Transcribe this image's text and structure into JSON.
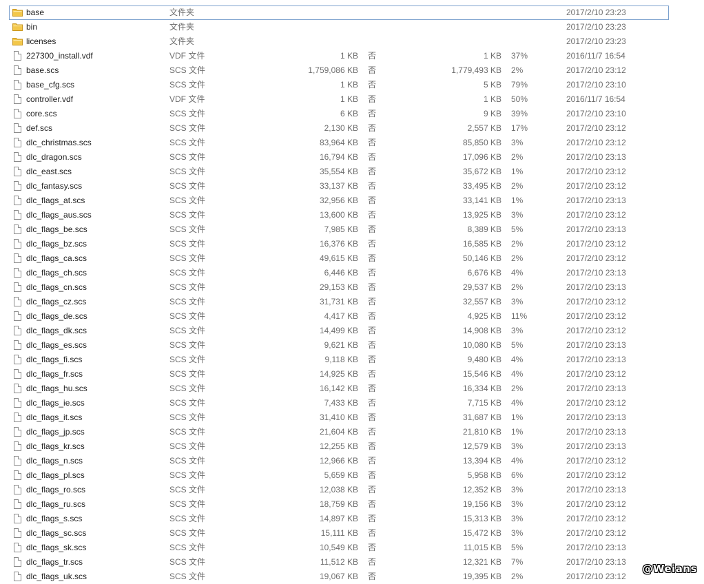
{
  "files": [
    {
      "icon": "folder-icon",
      "name": "base",
      "type": "文件夹",
      "size": "",
      "encrypted": "",
      "packed": "",
      "ratio": "",
      "date": "2017/2/10 23:23"
    },
    {
      "icon": "folder-icon",
      "name": "bin",
      "type": "文件夹",
      "size": "",
      "encrypted": "",
      "packed": "",
      "ratio": "",
      "date": "2017/2/10 23:23"
    },
    {
      "icon": "folder-icon",
      "name": "licenses",
      "type": "文件夹",
      "size": "",
      "encrypted": "",
      "packed": "",
      "ratio": "",
      "date": "2017/2/10 23:23"
    },
    {
      "icon": "file-icon",
      "name": "227300_install.vdf",
      "type": "VDF 文件",
      "size": "1 KB",
      "encrypted": "否",
      "packed": "1 KB",
      "ratio": "37%",
      "date": "2016/11/7 16:54"
    },
    {
      "icon": "file-icon",
      "name": "base.scs",
      "type": "SCS 文件",
      "size": "1,759,086 KB",
      "encrypted": "否",
      "packed": "1,779,493 KB",
      "ratio": "2%",
      "date": "2017/2/10 23:12"
    },
    {
      "icon": "file-icon",
      "name": "base_cfg.scs",
      "type": "SCS 文件",
      "size": "1 KB",
      "encrypted": "否",
      "packed": "5 KB",
      "ratio": "79%",
      "date": "2017/2/10 23:10"
    },
    {
      "icon": "file-icon",
      "name": "controller.vdf",
      "type": "VDF 文件",
      "size": "1 KB",
      "encrypted": "否",
      "packed": "1 KB",
      "ratio": "50%",
      "date": "2016/11/7 16:54"
    },
    {
      "icon": "file-icon",
      "name": "core.scs",
      "type": "SCS 文件",
      "size": "6 KB",
      "encrypted": "否",
      "packed": "9 KB",
      "ratio": "39%",
      "date": "2017/2/10 23:10"
    },
    {
      "icon": "file-icon",
      "name": "def.scs",
      "type": "SCS 文件",
      "size": "2,130 KB",
      "encrypted": "否",
      "packed": "2,557 KB",
      "ratio": "17%",
      "date": "2017/2/10 23:12"
    },
    {
      "icon": "file-icon",
      "name": "dlc_christmas.scs",
      "type": "SCS 文件",
      "size": "83,964 KB",
      "encrypted": "否",
      "packed": "85,850 KB",
      "ratio": "3%",
      "date": "2017/2/10 23:12"
    },
    {
      "icon": "file-icon",
      "name": "dlc_dragon.scs",
      "type": "SCS 文件",
      "size": "16,794 KB",
      "encrypted": "否",
      "packed": "17,096 KB",
      "ratio": "2%",
      "date": "2017/2/10 23:13"
    },
    {
      "icon": "file-icon",
      "name": "dlc_east.scs",
      "type": "SCS 文件",
      "size": "35,554 KB",
      "encrypted": "否",
      "packed": "35,672 KB",
      "ratio": "1%",
      "date": "2017/2/10 23:12"
    },
    {
      "icon": "file-icon",
      "name": "dlc_fantasy.scs",
      "type": "SCS 文件",
      "size": "33,137 KB",
      "encrypted": "否",
      "packed": "33,495 KB",
      "ratio": "2%",
      "date": "2017/2/10 23:12"
    },
    {
      "icon": "file-icon",
      "name": "dlc_flags_at.scs",
      "type": "SCS 文件",
      "size": "32,956 KB",
      "encrypted": "否",
      "packed": "33,141 KB",
      "ratio": "1%",
      "date": "2017/2/10 23:13"
    },
    {
      "icon": "file-icon",
      "name": "dlc_flags_aus.scs",
      "type": "SCS 文件",
      "size": "13,600 KB",
      "encrypted": "否",
      "packed": "13,925 KB",
      "ratio": "3%",
      "date": "2017/2/10 23:12"
    },
    {
      "icon": "file-icon",
      "name": "dlc_flags_be.scs",
      "type": "SCS 文件",
      "size": "7,985 KB",
      "encrypted": "否",
      "packed": "8,389 KB",
      "ratio": "5%",
      "date": "2017/2/10 23:13"
    },
    {
      "icon": "file-icon",
      "name": "dlc_flags_bz.scs",
      "type": "SCS 文件",
      "size": "16,376 KB",
      "encrypted": "否",
      "packed": "16,585 KB",
      "ratio": "2%",
      "date": "2017/2/10 23:12"
    },
    {
      "icon": "file-icon",
      "name": "dlc_flags_ca.scs",
      "type": "SCS 文件",
      "size": "49,615 KB",
      "encrypted": "否",
      "packed": "50,146 KB",
      "ratio": "2%",
      "date": "2017/2/10 23:12"
    },
    {
      "icon": "file-icon",
      "name": "dlc_flags_ch.scs",
      "type": "SCS 文件",
      "size": "6,446 KB",
      "encrypted": "否",
      "packed": "6,676 KB",
      "ratio": "4%",
      "date": "2017/2/10 23:13"
    },
    {
      "icon": "file-icon",
      "name": "dlc_flags_cn.scs",
      "type": "SCS 文件",
      "size": "29,153 KB",
      "encrypted": "否",
      "packed": "29,537 KB",
      "ratio": "2%",
      "date": "2017/2/10 23:13"
    },
    {
      "icon": "file-icon",
      "name": "dlc_flags_cz.scs",
      "type": "SCS 文件",
      "size": "31,731 KB",
      "encrypted": "否",
      "packed": "32,557 KB",
      "ratio": "3%",
      "date": "2017/2/10 23:12"
    },
    {
      "icon": "file-icon",
      "name": "dlc_flags_de.scs",
      "type": "SCS 文件",
      "size": "4,417 KB",
      "encrypted": "否",
      "packed": "4,925 KB",
      "ratio": "11%",
      "date": "2017/2/10 23:12"
    },
    {
      "icon": "file-icon",
      "name": "dlc_flags_dk.scs",
      "type": "SCS 文件",
      "size": "14,499 KB",
      "encrypted": "否",
      "packed": "14,908 KB",
      "ratio": "3%",
      "date": "2017/2/10 23:12"
    },
    {
      "icon": "file-icon",
      "name": "dlc_flags_es.scs",
      "type": "SCS 文件",
      "size": "9,621 KB",
      "encrypted": "否",
      "packed": "10,080 KB",
      "ratio": "5%",
      "date": "2017/2/10 23:13"
    },
    {
      "icon": "file-icon",
      "name": "dlc_flags_fi.scs",
      "type": "SCS 文件",
      "size": "9,118 KB",
      "encrypted": "否",
      "packed": "9,480 KB",
      "ratio": "4%",
      "date": "2017/2/10 23:13"
    },
    {
      "icon": "file-icon",
      "name": "dlc_flags_fr.scs",
      "type": "SCS 文件",
      "size": "14,925 KB",
      "encrypted": "否",
      "packed": "15,546 KB",
      "ratio": "4%",
      "date": "2017/2/10 23:12"
    },
    {
      "icon": "file-icon",
      "name": "dlc_flags_hu.scs",
      "type": "SCS 文件",
      "size": "16,142 KB",
      "encrypted": "否",
      "packed": "16,334 KB",
      "ratio": "2%",
      "date": "2017/2/10 23:13"
    },
    {
      "icon": "file-icon",
      "name": "dlc_flags_ie.scs",
      "type": "SCS 文件",
      "size": "7,433 KB",
      "encrypted": "否",
      "packed": "7,715 KB",
      "ratio": "4%",
      "date": "2017/2/10 23:12"
    },
    {
      "icon": "file-icon",
      "name": "dlc_flags_it.scs",
      "type": "SCS 文件",
      "size": "31,410 KB",
      "encrypted": "否",
      "packed": "31,687 KB",
      "ratio": "1%",
      "date": "2017/2/10 23:13"
    },
    {
      "icon": "file-icon",
      "name": "dlc_flags_jp.scs",
      "type": "SCS 文件",
      "size": "21,604 KB",
      "encrypted": "否",
      "packed": "21,810 KB",
      "ratio": "1%",
      "date": "2017/2/10 23:13"
    },
    {
      "icon": "file-icon",
      "name": "dlc_flags_kr.scs",
      "type": "SCS 文件",
      "size": "12,255 KB",
      "encrypted": "否",
      "packed": "12,579 KB",
      "ratio": "3%",
      "date": "2017/2/10 23:13"
    },
    {
      "icon": "file-icon",
      "name": "dlc_flags_n.scs",
      "type": "SCS 文件",
      "size": "12,966 KB",
      "encrypted": "否",
      "packed": "13,394 KB",
      "ratio": "4%",
      "date": "2017/2/10 23:12"
    },
    {
      "icon": "file-icon",
      "name": "dlc_flags_pl.scs",
      "type": "SCS 文件",
      "size": "5,659 KB",
      "encrypted": "否",
      "packed": "5,958 KB",
      "ratio": "6%",
      "date": "2017/2/10 23:12"
    },
    {
      "icon": "file-icon",
      "name": "dlc_flags_ro.scs",
      "type": "SCS 文件",
      "size": "12,038 KB",
      "encrypted": "否",
      "packed": "12,352 KB",
      "ratio": "3%",
      "date": "2017/2/10 23:13"
    },
    {
      "icon": "file-icon",
      "name": "dlc_flags_ru.scs",
      "type": "SCS 文件",
      "size": "18,759 KB",
      "encrypted": "否",
      "packed": "19,156 KB",
      "ratio": "3%",
      "date": "2017/2/10 23:12"
    },
    {
      "icon": "file-icon",
      "name": "dlc_flags_s.scs",
      "type": "SCS 文件",
      "size": "14,897 KB",
      "encrypted": "否",
      "packed": "15,313 KB",
      "ratio": "3%",
      "date": "2017/2/10 23:12"
    },
    {
      "icon": "file-icon",
      "name": "dlc_flags_sc.scs",
      "type": "SCS 文件",
      "size": "15,111 KB",
      "encrypted": "否",
      "packed": "15,472 KB",
      "ratio": "3%",
      "date": "2017/2/10 23:12"
    },
    {
      "icon": "file-icon",
      "name": "dlc_flags_sk.scs",
      "type": "SCS 文件",
      "size": "10,549 KB",
      "encrypted": "否",
      "packed": "11,015 KB",
      "ratio": "5%",
      "date": "2017/2/10 23:13"
    },
    {
      "icon": "file-icon",
      "name": "dlc_flags_tr.scs",
      "type": "SCS 文件",
      "size": "11,512 KB",
      "encrypted": "否",
      "packed": "12,321 KB",
      "ratio": "7%",
      "date": "2017/2/10 23:13"
    },
    {
      "icon": "file-icon",
      "name": "dlc_flags_uk.scs",
      "type": "SCS 文件",
      "size": "19,067 KB",
      "encrypted": "否",
      "packed": "19,395 KB",
      "ratio": "2%",
      "date": "2017/2/10 23:12"
    }
  ],
  "selected_index": 0,
  "watermark": "@Weians",
  "colors": {
    "folder": "#f3c74a",
    "selection_border": "#7da2ce",
    "meta_text": "#6d6d6d",
    "name_text": "#1e1e1e"
  }
}
